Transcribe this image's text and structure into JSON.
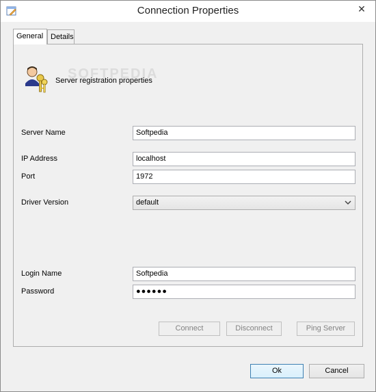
{
  "window": {
    "title": "Connection Properties",
    "close_glyph": "✕",
    "icon": "properties-icon"
  },
  "tabs": [
    {
      "label": "General",
      "active": true
    },
    {
      "label": "Details",
      "active": false
    }
  ],
  "header": {
    "icon": "user-keys-icon",
    "text": "Server registration properties",
    "watermark": "SOFTPEDIA"
  },
  "form": {
    "server_name_label": "Server Name",
    "server_name_value": "Softpedia",
    "ip_label": "IP Address",
    "ip_value": "localhost",
    "port_label": "Port",
    "port_value": "1972",
    "driver_label": "Driver Version",
    "driver_value": "default",
    "login_label": "Login Name",
    "login_value": "Softpedia",
    "password_label": "Password",
    "password_value": "●●●●●●"
  },
  "actions": {
    "connect": "Connect",
    "disconnect": "Disconnect",
    "ping": "Ping Server"
  },
  "footer": {
    "ok": "Ok",
    "cancel": "Cancel"
  }
}
